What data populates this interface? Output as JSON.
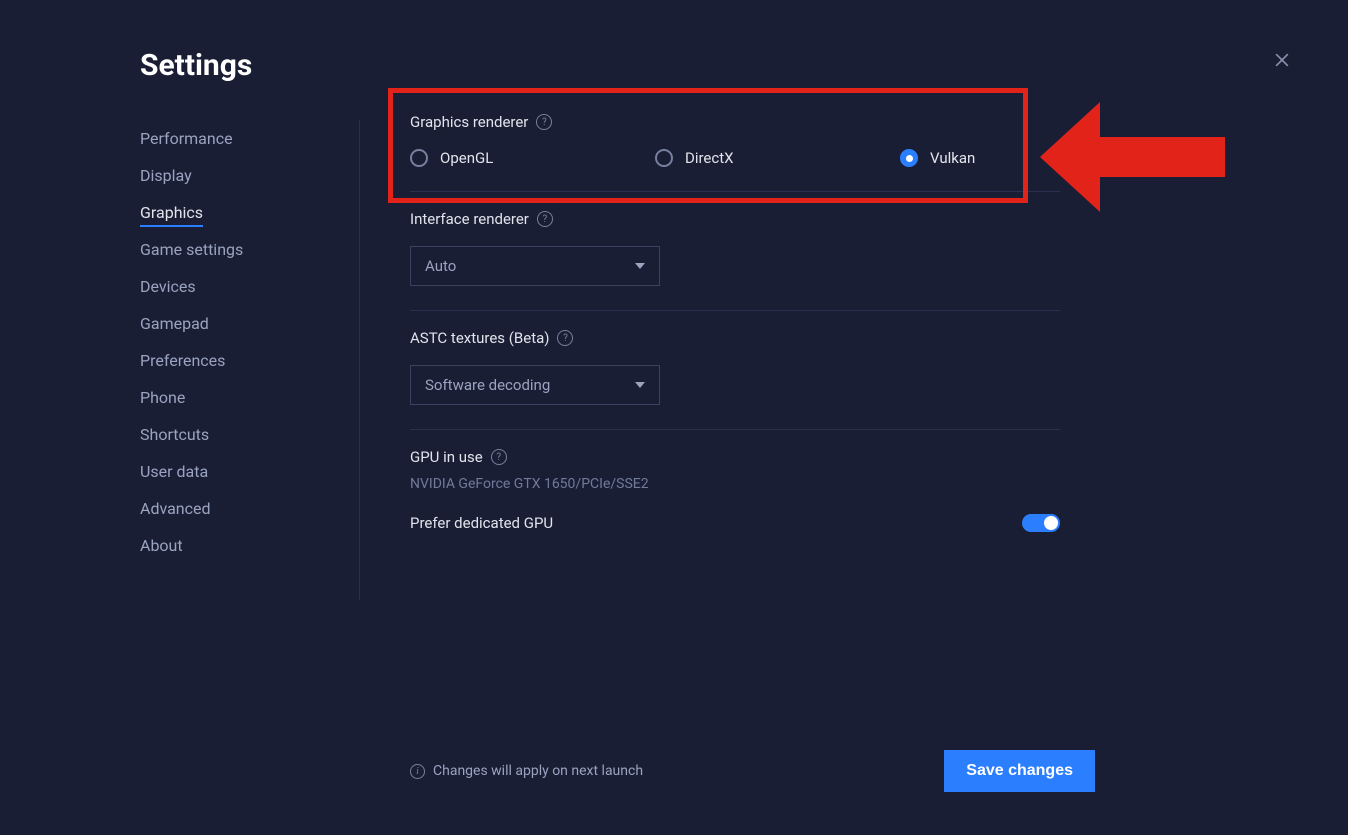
{
  "title": "Settings",
  "sidebar": {
    "items": [
      {
        "label": "Performance"
      },
      {
        "label": "Display"
      },
      {
        "label": "Graphics",
        "active": true
      },
      {
        "label": "Game settings"
      },
      {
        "label": "Devices"
      },
      {
        "label": "Gamepad"
      },
      {
        "label": "Preferences"
      },
      {
        "label": "Phone"
      },
      {
        "label": "Shortcuts"
      },
      {
        "label": "User data"
      },
      {
        "label": "Advanced"
      },
      {
        "label": "About"
      }
    ]
  },
  "graphics_renderer": {
    "label": "Graphics renderer",
    "options": [
      {
        "label": "OpenGL",
        "selected": false
      },
      {
        "label": "DirectX",
        "selected": false
      },
      {
        "label": "Vulkan",
        "selected": true
      }
    ]
  },
  "interface_renderer": {
    "label": "Interface renderer",
    "value": "Auto"
  },
  "astc": {
    "label": "ASTC textures (Beta)",
    "value": "Software decoding"
  },
  "gpu": {
    "label": "GPU in use",
    "name": "NVIDIA GeForce GTX 1650/PCIe/SSE2",
    "prefer_label": "Prefer dedicated GPU",
    "prefer_on": true
  },
  "footer": {
    "notice": "Changes will apply on next launch",
    "save": "Save changes"
  }
}
